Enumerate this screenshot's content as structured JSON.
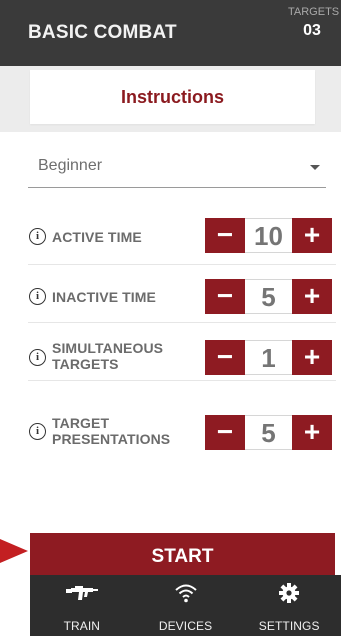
{
  "header": {
    "title": "BASIC COMBAT",
    "targets_label": "TARGETS",
    "targets_count": "03"
  },
  "instructions": {
    "label": "Instructions"
  },
  "level": {
    "selected": "Beginner"
  },
  "settings": [
    {
      "label": "ACTIVE TIME",
      "value": "10"
    },
    {
      "label": "INACTIVE TIME",
      "value": "5"
    },
    {
      "label": "SIMULTANEOUS TARGETS",
      "value": "1"
    },
    {
      "label": "TARGET PRESENTATIONS",
      "value": "5"
    }
  ],
  "stepper": {
    "minus": "−",
    "plus": "+"
  },
  "info_glyph": "i",
  "start": {
    "label": "START"
  },
  "tabs": [
    {
      "label": "TRAIN",
      "icon": "rifle-icon"
    },
    {
      "label": "DEVICES",
      "icon": "wifi-icon"
    },
    {
      "label": "SETTINGS",
      "icon": "gear-icon"
    }
  ],
  "colors": {
    "brand_red": "#8e1b22",
    "header_bg": "#3a3a3a",
    "tabbar_bg": "#2d2d2d",
    "arrow": "#c31f22"
  }
}
